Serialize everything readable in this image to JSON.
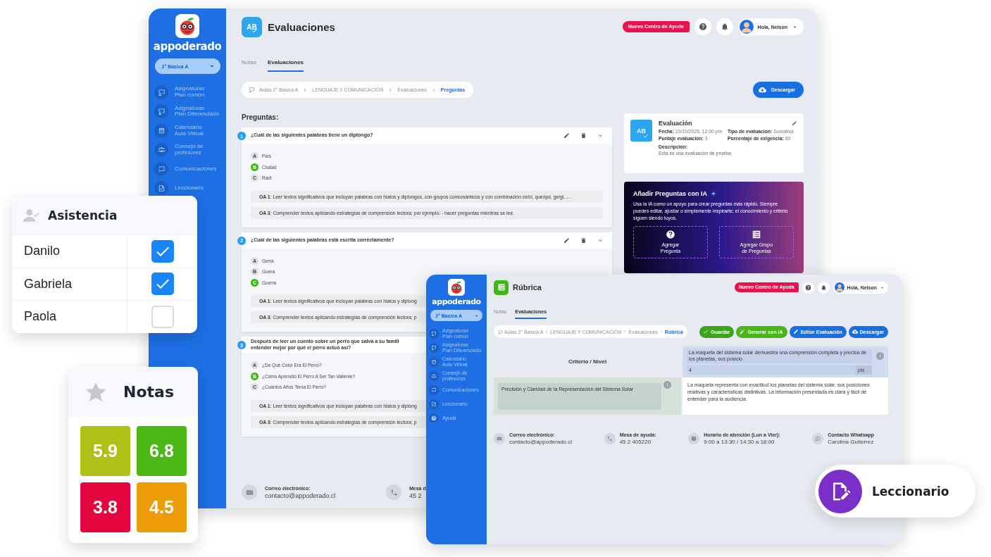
{
  "main_window": {
    "sidebar": {
      "brand": "appoderado",
      "class_select": "2° Basica A",
      "items": [
        {
          "label": "Asignaturas\nPlan común"
        },
        {
          "label": "Asignaturas\nPlan Diferenciado"
        },
        {
          "label": "Calendario\nAula Virtual"
        },
        {
          "label": "Consejo de\nprofesores"
        },
        {
          "label": "Comunicaciones"
        },
        {
          "label": "Leccionario"
        }
      ]
    },
    "title_icon": {
      "kind": "ab",
      "text": "AB"
    },
    "title": "Evaluaciones",
    "help_tag": "Nuevo Centro de Ayuda",
    "user": "Hola, Nelson",
    "tabs": [
      {
        "label": "Notas",
        "selected": false
      },
      {
        "label": "Evaluaciones",
        "selected": true
      }
    ],
    "breadcrumb": [
      {
        "label": "Aulas 2° Basica A",
        "current": false
      },
      {
        "label": "LENGUAJE Y COMUNICACIÓN",
        "current": false
      },
      {
        "label": "Evaluaciones",
        "current": false
      },
      {
        "label": "Preguntas",
        "current": true
      }
    ],
    "buttons": [
      {
        "label": "Descargar",
        "kind": "download"
      }
    ],
    "questions_heading": "Preguntas:",
    "questions": [
      {
        "number": "1",
        "text": "¿Cuál de las siguientes palabras tiene un diptongo?",
        "actions": true,
        "options": [
          {
            "letter": "A",
            "text": "País",
            "correct": false
          },
          {
            "letter": "B",
            "text": "Ciudad",
            "correct": true
          },
          {
            "letter": "C",
            "text": "Raúl",
            "correct": false
          }
        ],
        "objectives": [
          "**OA 1**: Leer textos significativos que incluyan palabras con hiatos y diptongos, con grupos consonánticos y con combinación ce/ci, que/qui, ge/gi, ...",
          "**OA 3**: Comprender textos aplicando estrategias de comprensión lectora; por ejemplo: - hacer preguntas mientras se lee."
        ]
      },
      {
        "number": "2",
        "text": "¿Cuál de las siguientes palabras está escrita correctamente?",
        "actions": true,
        "options": [
          {
            "letter": "A",
            "text": "Gerra",
            "correct": false
          },
          {
            "letter": "B",
            "text": "Guera",
            "correct": false
          },
          {
            "letter": "C",
            "text": "Guerra",
            "correct": true
          }
        ],
        "objectives": [
          "**OA 1**: Leer textos significativos que incluyan palabras con hiatos y diptong",
          "**OA 3**: Comprender textos aplicando estrategias de comprensión lectora; p"
        ]
      },
      {
        "number": "3",
        "text": "Después de leer un cuento sobre un perro que salva a su famili\nentender mejor por qué el perro actuó así?",
        "actions": false,
        "options": [
          {
            "letter": "A",
            "text": "¿De Qué Color Era El Perro?",
            "correct": false
          },
          {
            "letter": "B",
            "text": "¿Cómo Aprendió El Perro A Ser Tan Valiente?",
            "correct": true
          },
          {
            "letter": "C",
            "text": "¿Cuántos Años Tenía El Perro?",
            "correct": false
          }
        ],
        "objectives": [
          "**OA 1**: Leer textos significativos que incluyan palabras con hiatos y diptong",
          "**OA 3**: Comprender textos aplicando estrategias de comprensión lectora; p"
        ]
      }
    ],
    "evaluation_card": {
      "icon_text": "AB",
      "title": "Evaluación",
      "fields": [
        {
          "label": "Fecha:",
          "value": "10/10/2025, 12:00 pm"
        },
        {
          "label": "Tipo de evaluación:",
          "value": "Sumativa"
        },
        {
          "label": "Puntaje evaluación:",
          "value": "3"
        },
        {
          "label": "Porcentaje de exigencia:",
          "value": "60"
        }
      ],
      "description_label": "Descripción:",
      "description": "Esta es una evaluación de prueba"
    },
    "ai_card": {
      "title": "Añadir Preguntas con IA",
      "text": "Usa la IA como un apoyo para crear preguntas más rápido. Siempre puedes editar, ajustar o simplemente inspirarte: el conocimiento y criterio siguen siendo tuyos.",
      "buttons": [
        {
          "label": "Agregar\nPregunta"
        },
        {
          "label": "Agregar Grupo\nde Preguntas"
        }
      ]
    },
    "footer": [
      {
        "label": "Correo electrónico:",
        "value": "contacto@appoderado.cl"
      },
      {
        "label": "Mesa d",
        "value": "45 2"
      }
    ]
  },
  "rubric_window": {
    "sidebar": {
      "brand": "appoderado",
      "class_select": "2° Basica A",
      "items": [
        {
          "label": "Asignaturas\nPlan común"
        },
        {
          "label": "Asignaturas\nPlan Diferenciado"
        },
        {
          "label": "Calendario\nAula Virtual"
        },
        {
          "label": "Consejo de\nprofesores"
        },
        {
          "label": "Comunicaciones"
        },
        {
          "label": "Leccionario"
        },
        {
          "label": "Ayuda"
        }
      ]
    },
    "title_icon": {
      "kind": "list"
    },
    "title": "Rúbrica",
    "help_tag": "Nuevo Centro de Ayuda",
    "user": "Hola, Nelson",
    "tabs": [
      {
        "label": "Notas",
        "selected": false
      },
      {
        "label": "Evaluaciones",
        "selected": true
      }
    ],
    "breadcrumb": [
      {
        "label": "Aulas 2° Basica A",
        "current": false
      },
      {
        "label": "LENGUAJE Y COMUNICACIÓN",
        "current": false
      },
      {
        "label": "Evaluaciones",
        "current": false
      },
      {
        "label": "Rúbrica",
        "current": true
      }
    ],
    "buttons": [
      {
        "label": "Guardar",
        "kind": "save"
      },
      {
        "label": "Generar con IA",
        "kind": "ai"
      },
      {
        "label": "Editor Evaluación",
        "kind": "edit"
      },
      {
        "label": "Descargar",
        "kind": "download"
      }
    ],
    "rubric": {
      "header_label": "Criterio / Nivel",
      "levels": [
        {
          "description": "La maqueta del sistema solar demuestra una comprensión completa y precisa de los planetas, sus posicio",
          "points": "4",
          "unit": "pts"
        }
      ],
      "criteria": [
        {
          "name": "Precisión y Claridad de la Representación del Sistema Solar",
          "cells": [
            "La maqueta representa con exactitud los planetas del sistema solar, sus posiciones relativas y características distintivas. La información presentada es clara y fácil de entender para la audiencia."
          ]
        }
      ]
    },
    "footer": [
      {
        "label": "Correo electrónico:",
        "value": "contacto@appoderado.cl"
      },
      {
        "label": "Mesa de ayuda:",
        "value": "45 2 405220"
      },
      {
        "label": "Horario de atención (Lun a Vier):",
        "value": "9:00 a 13:30 / 14:30 a 18:00"
      },
      {
        "label": "Contacto Whatsapp",
        "value": "Carolina Gutierrez"
      }
    ]
  },
  "attendance_card": {
    "title": "Asistencia",
    "students": [
      {
        "name": "Danilo",
        "checked": true
      },
      {
        "name": "Gabriela",
        "checked": true
      },
      {
        "name": "Paola",
        "checked": false
      }
    ]
  },
  "grades_card": {
    "title": "Notas",
    "grades": [
      {
        "value": "5.9",
        "color": "#afc017"
      },
      {
        "value": "6.8",
        "color": "#4cb815"
      },
      {
        "value": "3.8",
        "color": "#e5053f"
      },
      {
        "value": "4.5",
        "color": "#ec9c09"
      }
    ]
  },
  "feature_badge": {
    "label": "Leccionario"
  }
}
